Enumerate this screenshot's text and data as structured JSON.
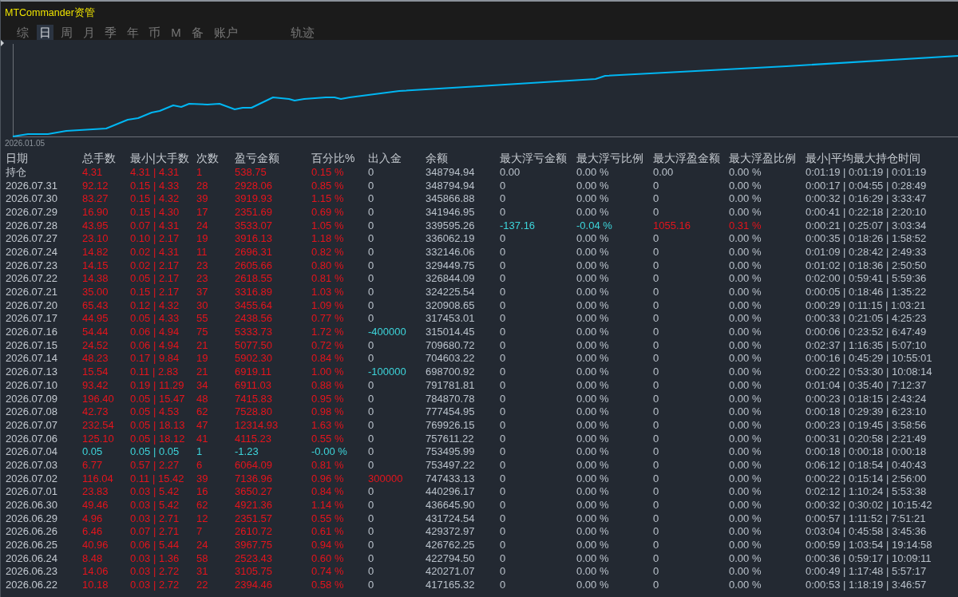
{
  "window": {
    "title": "MTCommander资管"
  },
  "tabs": [
    {
      "label": "综",
      "selected": false
    },
    {
      "label": "日",
      "selected": true
    },
    {
      "label": "周",
      "selected": false
    },
    {
      "label": "月",
      "selected": false
    },
    {
      "label": "季",
      "selected": false
    },
    {
      "label": "年",
      "selected": false
    },
    {
      "label": "币",
      "selected": false
    },
    {
      "label": "M",
      "selected": false
    },
    {
      "label": "备",
      "selected": false
    },
    {
      "label": "账户",
      "selected": false
    }
  ],
  "trail_tab": {
    "label": "轨迹",
    "selected": false
  },
  "chart": {
    "start_label": "2026.01.05"
  },
  "table": {
    "columns": [
      "日期",
      "总手数",
      "最小|大手数",
      "次数",
      "盈亏金额",
      "百分比%",
      "出入金",
      "余额",
      "最大浮亏金额",
      "最大浮亏比例",
      "最大浮盈金额",
      "最大浮盈比例",
      "最小|平均最大持仓时间"
    ],
    "rows": [
      {
        "date": "持仓",
        "loss": false,
        "lots": "4.31",
        "lot_range": "4.31 | 4.31",
        "trades": "1",
        "pnl": "538.75",
        "pnl_pct": "0.15 %",
        "cash_flow": "0",
        "deposit": false,
        "withdrawal": false,
        "balance": "348794.94",
        "float_loss": "0.00",
        "float_loss_pct": "0.00 %",
        "float_profit": "0.00",
        "float_profit_pct": "0.00 %",
        "floating": false,
        "hold_times": "0:01:19 | 0:01:19 | 0:01:19"
      },
      {
        "date": "2026.07.31",
        "loss": false,
        "lots": "92.12",
        "lot_range": "0.15 | 4.33",
        "trades": "28",
        "pnl": "2928.06",
        "pnl_pct": "0.85 %",
        "cash_flow": "0",
        "deposit": false,
        "withdrawal": false,
        "balance": "348794.94",
        "float_loss": "0",
        "float_loss_pct": "0.00 %",
        "float_profit": "0",
        "float_profit_pct": "0.00 %",
        "floating": false,
        "hold_times": "0:00:17 | 0:04:55 | 0:28:49"
      },
      {
        "date": "2026.07.30",
        "loss": false,
        "lots": "83.27",
        "lot_range": "0.15 | 4.32",
        "trades": "39",
        "pnl": "3919.93",
        "pnl_pct": "1.15 %",
        "cash_flow": "0",
        "deposit": false,
        "withdrawal": false,
        "balance": "345866.88",
        "float_loss": "0",
        "float_loss_pct": "0.00 %",
        "float_profit": "0",
        "float_profit_pct": "0.00 %",
        "floating": false,
        "hold_times": "0:00:32 | 0:16:29 | 3:33:47"
      },
      {
        "date": "2026.07.29",
        "loss": false,
        "lots": "16.90",
        "lot_range": "0.15 | 4.30",
        "trades": "17",
        "pnl": "2351.69",
        "pnl_pct": "0.69 %",
        "cash_flow": "0",
        "deposit": false,
        "withdrawal": false,
        "balance": "341946.95",
        "float_loss": "0",
        "float_loss_pct": "0.00 %",
        "float_profit": "0",
        "float_profit_pct": "0.00 %",
        "floating": false,
        "hold_times": "0:00:41 | 0:22:18 | 2:20:10"
      },
      {
        "date": "2026.07.28",
        "loss": false,
        "lots": "43.95",
        "lot_range": "0.07 | 4.31",
        "trades": "24",
        "pnl": "3533.07",
        "pnl_pct": "1.05 %",
        "cash_flow": "0",
        "deposit": false,
        "withdrawal": false,
        "balance": "339595.26",
        "float_loss": "-137.16",
        "float_loss_pct": "-0.04 %",
        "float_profit": "1055.16",
        "float_profit_pct": "0.31 %",
        "floating": true,
        "hold_times": "0:00:21 | 0:25:07 | 3:03:34"
      },
      {
        "date": "2026.07.27",
        "loss": false,
        "lots": "23.10",
        "lot_range": "0.10 | 2.17",
        "trades": "19",
        "pnl": "3916.13",
        "pnl_pct": "1.18 %",
        "cash_flow": "0",
        "deposit": false,
        "withdrawal": false,
        "balance": "336062.19",
        "float_loss": "0",
        "float_loss_pct": "0.00 %",
        "float_profit": "0",
        "float_profit_pct": "0.00 %",
        "floating": false,
        "hold_times": "0:00:35 | 0:18:26 | 1:58:52"
      },
      {
        "date": "2026.07.24",
        "loss": false,
        "lots": "14.82",
        "lot_range": "0.02 | 4.31",
        "trades": "11",
        "pnl": "2696.31",
        "pnl_pct": "0.82 %",
        "cash_flow": "0",
        "deposit": false,
        "withdrawal": false,
        "balance": "332146.06",
        "float_loss": "0",
        "float_loss_pct": "0.00 %",
        "float_profit": "0",
        "float_profit_pct": "0.00 %",
        "floating": false,
        "hold_times": "0:01:09 | 0:28:42 | 2:49:33"
      },
      {
        "date": "2026.07.23",
        "loss": false,
        "lots": "14.15",
        "lot_range": "0.02 | 2.17",
        "trades": "23",
        "pnl": "2605.66",
        "pnl_pct": "0.80 %",
        "cash_flow": "0",
        "deposit": false,
        "withdrawal": false,
        "balance": "329449.75",
        "float_loss": "0",
        "float_loss_pct": "0.00 %",
        "float_profit": "0",
        "float_profit_pct": "0.00 %",
        "floating": false,
        "hold_times": "0:01:02 | 0:18:36 | 2:50:50"
      },
      {
        "date": "2026.07.22",
        "loss": false,
        "lots": "14.38",
        "lot_range": "0.05 | 2.17",
        "trades": "23",
        "pnl": "2618.55",
        "pnl_pct": "0.81 %",
        "cash_flow": "0",
        "deposit": false,
        "withdrawal": false,
        "balance": "326844.09",
        "float_loss": "0",
        "float_loss_pct": "0.00 %",
        "float_profit": "0",
        "float_profit_pct": "0.00 %",
        "floating": false,
        "hold_times": "0:02:00 | 0:59:41 | 5:59:36"
      },
      {
        "date": "2026.07.21",
        "loss": false,
        "lots": "35.00",
        "lot_range": "0.15 | 2.17",
        "trades": "37",
        "pnl": "3316.89",
        "pnl_pct": "1.03 %",
        "cash_flow": "0",
        "deposit": false,
        "withdrawal": false,
        "balance": "324225.54",
        "float_loss": "0",
        "float_loss_pct": "0.00 %",
        "float_profit": "0",
        "float_profit_pct": "0.00 %",
        "floating": false,
        "hold_times": "0:00:05 | 0:18:46 | 1:35:22"
      },
      {
        "date": "2026.07.20",
        "loss": false,
        "lots": "65.43",
        "lot_range": "0.12 | 4.32",
        "trades": "30",
        "pnl": "3455.64",
        "pnl_pct": "1.09 %",
        "cash_flow": "0",
        "deposit": false,
        "withdrawal": false,
        "balance": "320908.65",
        "float_loss": "0",
        "float_loss_pct": "0.00 %",
        "float_profit": "0",
        "float_profit_pct": "0.00 %",
        "floating": false,
        "hold_times": "0:00:29 | 0:11:15 | 1:03:21"
      },
      {
        "date": "2026.07.17",
        "loss": false,
        "lots": "44.95",
        "lot_range": "0.05 | 4.33",
        "trades": "55",
        "pnl": "2438.56",
        "pnl_pct": "0.77 %",
        "cash_flow": "0",
        "deposit": false,
        "withdrawal": false,
        "balance": "317453.01",
        "float_loss": "0",
        "float_loss_pct": "0.00 %",
        "float_profit": "0",
        "float_profit_pct": "0.00 %",
        "floating": false,
        "hold_times": "0:00:33 | 0:21:05 | 4:25:23"
      },
      {
        "date": "2026.07.16",
        "loss": false,
        "lots": "54.44",
        "lot_range": "0.06 | 4.94",
        "trades": "75",
        "pnl": "5333.73",
        "pnl_pct": "1.72 %",
        "cash_flow": "-400000",
        "deposit": false,
        "withdrawal": true,
        "balance": "315014.45",
        "float_loss": "0",
        "float_loss_pct": "0.00 %",
        "float_profit": "0",
        "float_profit_pct": "0.00 %",
        "floating": false,
        "hold_times": "0:00:06 | 0:23:52 | 6:47:49"
      },
      {
        "date": "2026.07.15",
        "loss": false,
        "lots": "24.52",
        "lot_range": "0.06 | 4.94",
        "trades": "21",
        "pnl": "5077.50",
        "pnl_pct": "0.72 %",
        "cash_flow": "0",
        "deposit": false,
        "withdrawal": false,
        "balance": "709680.72",
        "float_loss": "0",
        "float_loss_pct": "0.00 %",
        "float_profit": "0",
        "float_profit_pct": "0.00 %",
        "floating": false,
        "hold_times": "0:02:37 | 1:16:35 | 5:07:10"
      },
      {
        "date": "2026.07.14",
        "loss": false,
        "lots": "48.23",
        "lot_range": "0.17 | 9.84",
        "trades": "19",
        "pnl": "5902.30",
        "pnl_pct": "0.84 %",
        "cash_flow": "0",
        "deposit": false,
        "withdrawal": false,
        "balance": "704603.22",
        "float_loss": "0",
        "float_loss_pct": "0.00 %",
        "float_profit": "0",
        "float_profit_pct": "0.00 %",
        "floating": false,
        "hold_times": "0:00:16 | 0:45:29 | 10:55:01"
      },
      {
        "date": "2026.07.13",
        "loss": false,
        "lots": "15.54",
        "lot_range": "0.11 | 2.83",
        "trades": "21",
        "pnl": "6919.11",
        "pnl_pct": "1.00 %",
        "cash_flow": "-100000",
        "deposit": false,
        "withdrawal": true,
        "balance": "698700.92",
        "float_loss": "0",
        "float_loss_pct": "0.00 %",
        "float_profit": "0",
        "float_profit_pct": "0.00 %",
        "floating": false,
        "hold_times": "0:00:22 | 0:53:30 | 10:08:14"
      },
      {
        "date": "2026.07.10",
        "loss": false,
        "lots": "93.42",
        "lot_range": "0.19 | 11.29",
        "trades": "34",
        "pnl": "6911.03",
        "pnl_pct": "0.88 %",
        "cash_flow": "0",
        "deposit": false,
        "withdrawal": false,
        "balance": "791781.81",
        "float_loss": "0",
        "float_loss_pct": "0.00 %",
        "float_profit": "0",
        "float_profit_pct": "0.00 %",
        "floating": false,
        "hold_times": "0:01:04 | 0:35:40 | 7:12:37"
      },
      {
        "date": "2026.07.09",
        "loss": false,
        "lots": "196.40",
        "lot_range": "0.05 | 15.47",
        "trades": "48",
        "pnl": "7415.83",
        "pnl_pct": "0.95 %",
        "cash_flow": "0",
        "deposit": false,
        "withdrawal": false,
        "balance": "784870.78",
        "float_loss": "0",
        "float_loss_pct": "0.00 %",
        "float_profit": "0",
        "float_profit_pct": "0.00 %",
        "floating": false,
        "hold_times": "0:00:23 | 0:18:15 | 2:43:24"
      },
      {
        "date": "2026.07.08",
        "loss": false,
        "lots": "42.73",
        "lot_range": "0.05 | 4.53",
        "trades": "62",
        "pnl": "7528.80",
        "pnl_pct": "0.98 %",
        "cash_flow": "0",
        "deposit": false,
        "withdrawal": false,
        "balance": "777454.95",
        "float_loss": "0",
        "float_loss_pct": "0.00 %",
        "float_profit": "0",
        "float_profit_pct": "0.00 %",
        "floating": false,
        "hold_times": "0:00:18 | 0:29:39 | 6:23:10"
      },
      {
        "date": "2026.07.07",
        "loss": false,
        "lots": "232.54",
        "lot_range": "0.05 | 18.13",
        "trades": "47",
        "pnl": "12314.93",
        "pnl_pct": "1.63 %",
        "cash_flow": "0",
        "deposit": false,
        "withdrawal": false,
        "balance": "769926.15",
        "float_loss": "0",
        "float_loss_pct": "0.00 %",
        "float_profit": "0",
        "float_profit_pct": "0.00 %",
        "floating": false,
        "hold_times": "0:00:23 | 0:19:45 | 3:58:56"
      },
      {
        "date": "2026.07.06",
        "loss": false,
        "lots": "125.10",
        "lot_range": "0.05 | 18.12",
        "trades": "41",
        "pnl": "4115.23",
        "pnl_pct": "0.55 %",
        "cash_flow": "0",
        "deposit": false,
        "withdrawal": false,
        "balance": "757611.22",
        "float_loss": "0",
        "float_loss_pct": "0.00 %",
        "float_profit": "0",
        "float_profit_pct": "0.00 %",
        "floating": false,
        "hold_times": "0:00:31 | 0:20:58 | 2:21:49"
      },
      {
        "date": "2026.07.04",
        "loss": true,
        "lots": "0.05",
        "lot_range": "0.05 | 0.05",
        "trades": "1",
        "pnl": "-1.23",
        "pnl_pct": "-0.00 %",
        "cash_flow": "0",
        "deposit": false,
        "withdrawal": false,
        "balance": "753495.99",
        "float_loss": "0",
        "float_loss_pct": "0.00 %",
        "float_profit": "0",
        "float_profit_pct": "0.00 %",
        "floating": false,
        "hold_times": "0:00:18 | 0:00:18 | 0:00:18"
      },
      {
        "date": "2026.07.03",
        "loss": false,
        "lots": "6.77",
        "lot_range": "0.57 | 2.27",
        "trades": "6",
        "pnl": "6064.09",
        "pnl_pct": "0.81 %",
        "cash_flow": "0",
        "deposit": false,
        "withdrawal": false,
        "balance": "753497.22",
        "float_loss": "0",
        "float_loss_pct": "0.00 %",
        "float_profit": "0",
        "float_profit_pct": "0.00 %",
        "floating": false,
        "hold_times": "0:06:12 | 0:18:54 | 0:40:43"
      },
      {
        "date": "2026.07.02",
        "loss": false,
        "lots": "116.04",
        "lot_range": "0.11 | 15.42",
        "trades": "39",
        "pnl": "7136.96",
        "pnl_pct": "0.96 %",
        "cash_flow": "300000",
        "deposit": true,
        "withdrawal": false,
        "balance": "747433.13",
        "float_loss": "0",
        "float_loss_pct": "0.00 %",
        "float_profit": "0",
        "float_profit_pct": "0.00 %",
        "floating": false,
        "hold_times": "0:00:22 | 0:15:14 | 2:56:00"
      },
      {
        "date": "2026.07.01",
        "loss": false,
        "lots": "23.83",
        "lot_range": "0.03 | 5.42",
        "trades": "16",
        "pnl": "3650.27",
        "pnl_pct": "0.84 %",
        "cash_flow": "0",
        "deposit": false,
        "withdrawal": false,
        "balance": "440296.17",
        "float_loss": "0",
        "float_loss_pct": "0.00 %",
        "float_profit": "0",
        "float_profit_pct": "0.00 %",
        "floating": false,
        "hold_times": "0:02:12 | 1:10:24 | 5:53:38"
      },
      {
        "date": "2026.06.30",
        "loss": false,
        "lots": "49.46",
        "lot_range": "0.03 | 5.42",
        "trades": "62",
        "pnl": "4921.36",
        "pnl_pct": "1.14 %",
        "cash_flow": "0",
        "deposit": false,
        "withdrawal": false,
        "balance": "436645.90",
        "float_loss": "0",
        "float_loss_pct": "0.00 %",
        "float_profit": "0",
        "float_profit_pct": "0.00 %",
        "floating": false,
        "hold_times": "0:00:32 | 0:30:02 | 10:15:42"
      },
      {
        "date": "2026.06.29",
        "loss": false,
        "lots": "4.96",
        "lot_range": "0.03 | 2.71",
        "trades": "12",
        "pnl": "2351.57",
        "pnl_pct": "0.55 %",
        "cash_flow": "0",
        "deposit": false,
        "withdrawal": false,
        "balance": "431724.54",
        "float_loss": "0",
        "float_loss_pct": "0.00 %",
        "float_profit": "0",
        "float_profit_pct": "0.00 %",
        "floating": false,
        "hold_times": "0:00:57 | 1:11:52 | 7:51:21"
      },
      {
        "date": "2026.06.26",
        "loss": false,
        "lots": "6.46",
        "lot_range": "0.07 | 2.71",
        "trades": "7",
        "pnl": "2610.72",
        "pnl_pct": "0.61 %",
        "cash_flow": "0",
        "deposit": false,
        "withdrawal": false,
        "balance": "429372.97",
        "float_loss": "0",
        "float_loss_pct": "0.00 %",
        "float_profit": "0",
        "float_profit_pct": "0.00 %",
        "floating": false,
        "hold_times": "0:03:04 | 0:45:58 | 3:45:36"
      },
      {
        "date": "2026.06.25",
        "loss": false,
        "lots": "40.96",
        "lot_range": "0.06 | 5.44",
        "trades": "24",
        "pnl": "3967.75",
        "pnl_pct": "0.94 %",
        "cash_flow": "0",
        "deposit": false,
        "withdrawal": false,
        "balance": "426762.25",
        "float_loss": "0",
        "float_loss_pct": "0.00 %",
        "float_profit": "0",
        "float_profit_pct": "0.00 %",
        "floating": false,
        "hold_times": "0:00:59 | 1:03:54 | 19:14:58"
      },
      {
        "date": "2026.06.24",
        "loss": false,
        "lots": "8.48",
        "lot_range": "0.03 | 1.36",
        "trades": "58",
        "pnl": "2523.43",
        "pnl_pct": "0.60 %",
        "cash_flow": "0",
        "deposit": false,
        "withdrawal": false,
        "balance": "422794.50",
        "float_loss": "0",
        "float_loss_pct": "0.00 %",
        "float_profit": "0",
        "float_profit_pct": "0.00 %",
        "floating": false,
        "hold_times": "0:00:36 | 0:59:17 | 10:09:11"
      },
      {
        "date": "2026.06.23",
        "loss": false,
        "lots": "14.06",
        "lot_range": "0.03 | 2.72",
        "trades": "31",
        "pnl": "3105.75",
        "pnl_pct": "0.74 %",
        "cash_flow": "0",
        "deposit": false,
        "withdrawal": false,
        "balance": "420271.07",
        "float_loss": "0",
        "float_loss_pct": "0.00 %",
        "float_profit": "0",
        "float_profit_pct": "0.00 %",
        "floating": false,
        "hold_times": "0:00:49 | 1:17:48 | 5:57:17"
      },
      {
        "date": "2026.06.22",
        "loss": false,
        "lots": "10.18",
        "lot_range": "0.03 | 2.72",
        "trades": "22",
        "pnl": "2394.46",
        "pnl_pct": "0.58 %",
        "cash_flow": "0",
        "deposit": false,
        "withdrawal": false,
        "balance": "417165.32",
        "float_loss": "0",
        "float_loss_pct": "0.00 %",
        "float_profit": "0",
        "float_profit_pct": "0.00 %",
        "floating": false,
        "hold_times": "0:00:53 | 1:18:19 | 3:46:57"
      }
    ]
  }
}
